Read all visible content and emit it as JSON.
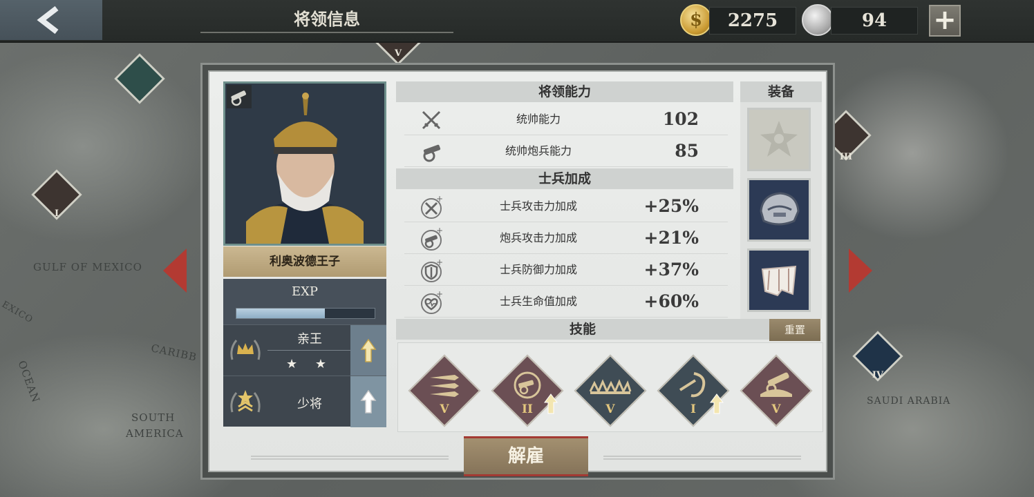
{
  "header": {
    "title": "将领信息",
    "gold": "2275",
    "medals": "94"
  },
  "map": {
    "labels": [
      "GULF OF MEXICO",
      "SOUTH",
      "AMERICA",
      "CARIBB",
      "SAUDI ARABIA",
      "OCEAN",
      "EXICO"
    ],
    "markers": [
      "I",
      "III",
      "IV",
      "V"
    ]
  },
  "general": {
    "name": "利奥波德王子",
    "exp_label": "EXP",
    "exp_progress": 0.64,
    "title_rank": "亲王",
    "stars": "★ ★",
    "military_rank": "少将"
  },
  "abilities": {
    "header": "将领能力",
    "items": [
      {
        "label": "统帅能力",
        "value": "102",
        "icon": "crossed-swords-icon"
      },
      {
        "label": "统帅炮兵能力",
        "value": "85",
        "icon": "cannon-icon"
      }
    ]
  },
  "bonuses": {
    "header": "士兵加成",
    "items": [
      {
        "label": "士兵攻击力加成",
        "value": "+25%",
        "icon": "attack-plus-icon"
      },
      {
        "label": "炮兵攻击力加成",
        "value": "+21%",
        "icon": "artillery-plus-icon"
      },
      {
        "label": "士兵防御力加成",
        "value": "+37%",
        "icon": "shield-plus-icon"
      },
      {
        "label": "士兵生命值加成",
        "value": "+60%",
        "icon": "heart-plus-icon"
      }
    ]
  },
  "equipment": {
    "header": "装备",
    "slots": [
      "order-medal-empty-icon",
      "helmet-icon",
      "cloth-sash-icon"
    ]
  },
  "skills": {
    "header": "技能",
    "reset_label": "重置",
    "items": [
      {
        "level": "V",
        "icon": "rockets-icon",
        "upgrade": false,
        "color": "#6b4f54"
      },
      {
        "level": "II",
        "icon": "artillery-target-icon",
        "upgrade": true,
        "color": "#6b4f54"
      },
      {
        "level": "V",
        "icon": "barbed-wire-icon",
        "upgrade": false,
        "color": "#3f4c55"
      },
      {
        "level": "I",
        "icon": "hook-attack-icon",
        "upgrade": true,
        "color": "#3f4c55"
      },
      {
        "level": "V",
        "icon": "heavy-cannon-icon",
        "upgrade": false,
        "color": "#6b4f54"
      }
    ]
  },
  "actions": {
    "dismiss_label": "解雇"
  },
  "colors": {
    "accent_red": "#b33a32",
    "gold_text": "#e3c77e",
    "panel_bg": "#e8eae8"
  }
}
